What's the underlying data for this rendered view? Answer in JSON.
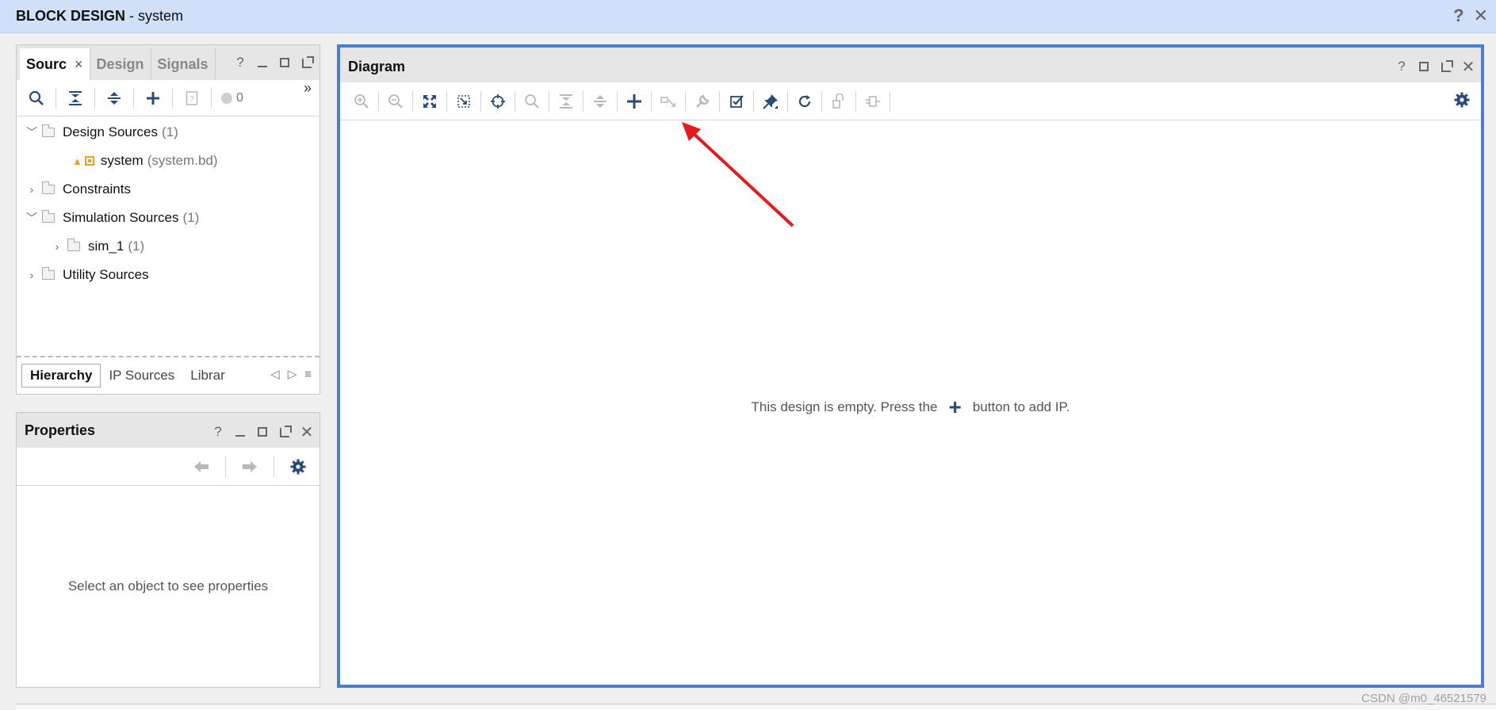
{
  "window": {
    "title_bold": "BLOCK DESIGN",
    "separator": "-",
    "title_name": "system",
    "help": "?",
    "close": "✕"
  },
  "sources": {
    "tabs": [
      {
        "label": "Sourc",
        "active": true
      },
      {
        "label": "Design",
        "active": false
      },
      {
        "label": "Signals",
        "active": false
      }
    ],
    "tab_close": "×",
    "help": "?",
    "error_count": "0",
    "more": "»",
    "tree": [
      {
        "label": "Design Sources",
        "count": "(1)"
      },
      {
        "label": "system",
        "count": "(system.bd)"
      },
      {
        "label": "Constraints",
        "count": ""
      },
      {
        "label": "Simulation Sources",
        "count": "(1)"
      },
      {
        "label": "sim_1",
        "count": "(1)"
      },
      {
        "label": "Utility Sources",
        "count": ""
      }
    ],
    "bottom_tabs": [
      "Hierarchy",
      "IP Sources",
      "Librar"
    ],
    "bottom_nav": [
      "◁",
      "▷",
      "≡"
    ]
  },
  "properties": {
    "title": "Properties",
    "help": "?",
    "placeholder": "Select an object to see properties"
  },
  "diagram": {
    "title": "Diagram",
    "help": "?",
    "empty_before": "This design is empty. Press the",
    "empty_plus": "+",
    "empty_after": "button to add IP."
  },
  "watermark": "CSDN @m0_46521579",
  "colors": {
    "accent": "#4a7ed0",
    "icon": "#2b4a78",
    "title_bar": "#cfe0f8",
    "arrow": "#e8191b"
  }
}
